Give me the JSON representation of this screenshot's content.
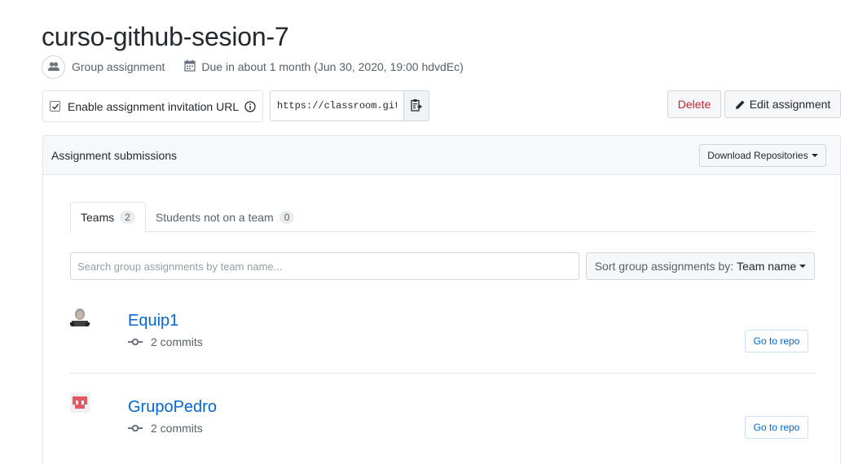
{
  "assignment": {
    "title": "curso-github-sesion-7",
    "type_label": "Group assignment",
    "due_text": "Due in about 1 month (Jun 30, 2020, 19:00 hdvdEc)"
  },
  "invitation": {
    "enabled": true,
    "label": "Enable assignment invitation URL",
    "url_value": "https://classroom.github.com/a/"
  },
  "actions": {
    "delete_label": "Delete",
    "edit_label": "Edit assignment"
  },
  "submissions": {
    "title": "Assignment submissions",
    "download_label": "Download Repositories",
    "tabs": [
      {
        "label": "Teams",
        "count": "2",
        "active": true
      },
      {
        "label": "Students not on a team",
        "count": "0",
        "active": false
      }
    ],
    "search_placeholder": "Search group assignments by team name...",
    "sort_prefix": "Sort group assignments by:",
    "sort_value": "Team name",
    "teams": [
      {
        "name": "Equip1",
        "commits": "2 commits",
        "button_label": "Go to repo"
      },
      {
        "name": "GrupoPedro",
        "commits": "2 commits",
        "button_label": "Go to repo"
      }
    ]
  },
  "colors": {
    "link": "#0366d6",
    "danger": "#cb2431",
    "border": "#e1e4e8"
  }
}
